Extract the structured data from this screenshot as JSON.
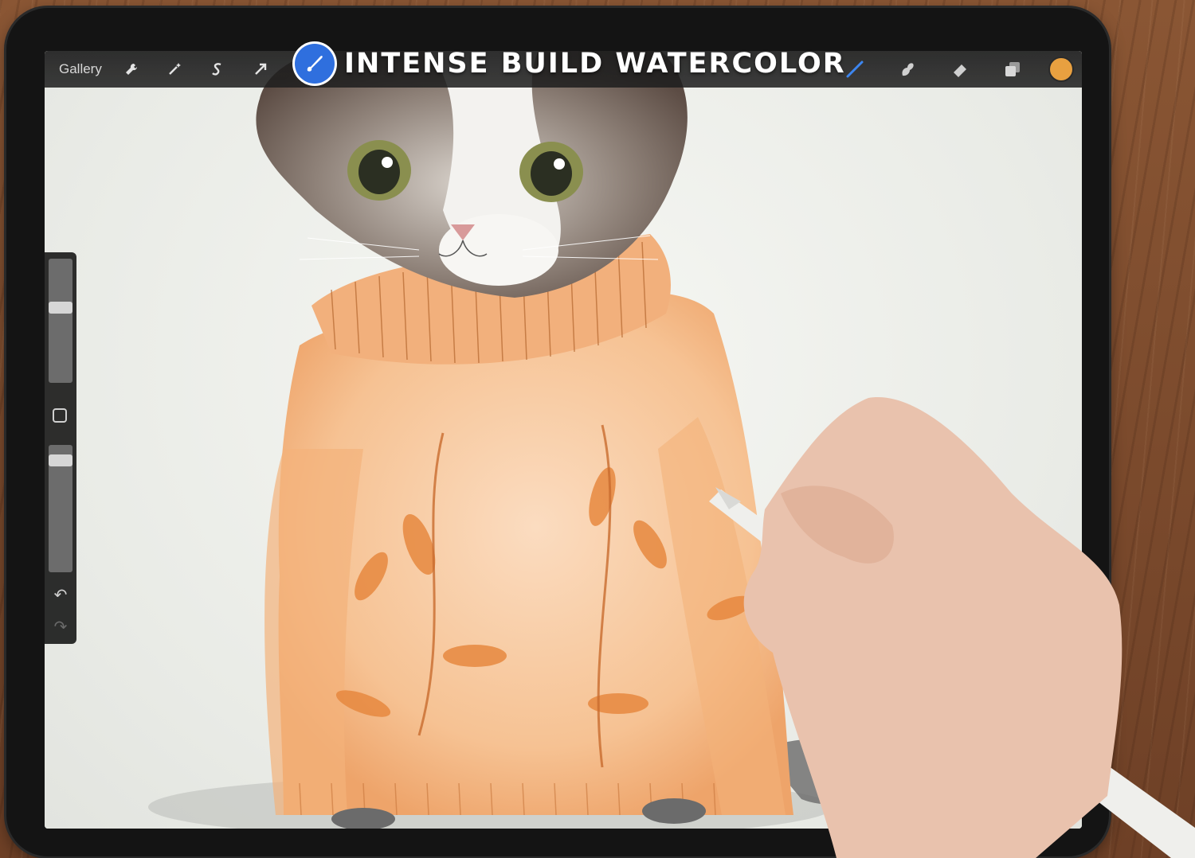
{
  "app": {
    "gallery_label": "Gallery",
    "overlay_title": "INTENSE BUILD WATERCOLOR",
    "current_color": "#e8a040",
    "accent_color": "#2f6fde"
  },
  "toolbar_left": [
    {
      "name": "actions",
      "icon": "wrench-icon"
    },
    {
      "name": "adjustments",
      "icon": "magic-wand-icon"
    },
    {
      "name": "selection",
      "icon": "selection-s-icon"
    },
    {
      "name": "transform",
      "icon": "arrow-cursor-icon"
    }
  ],
  "toolbar_right": [
    {
      "name": "brush",
      "icon": "brush-icon",
      "active": true
    },
    {
      "name": "smudge",
      "icon": "smudge-icon"
    },
    {
      "name": "eraser",
      "icon": "eraser-icon"
    },
    {
      "name": "layers",
      "icon": "layers-icon"
    }
  ],
  "sidebar": {
    "brush_size_level": 0.62,
    "opacity_level": 0.92,
    "undo_icon": "undo-icon",
    "redo_icon": "redo-icon"
  }
}
